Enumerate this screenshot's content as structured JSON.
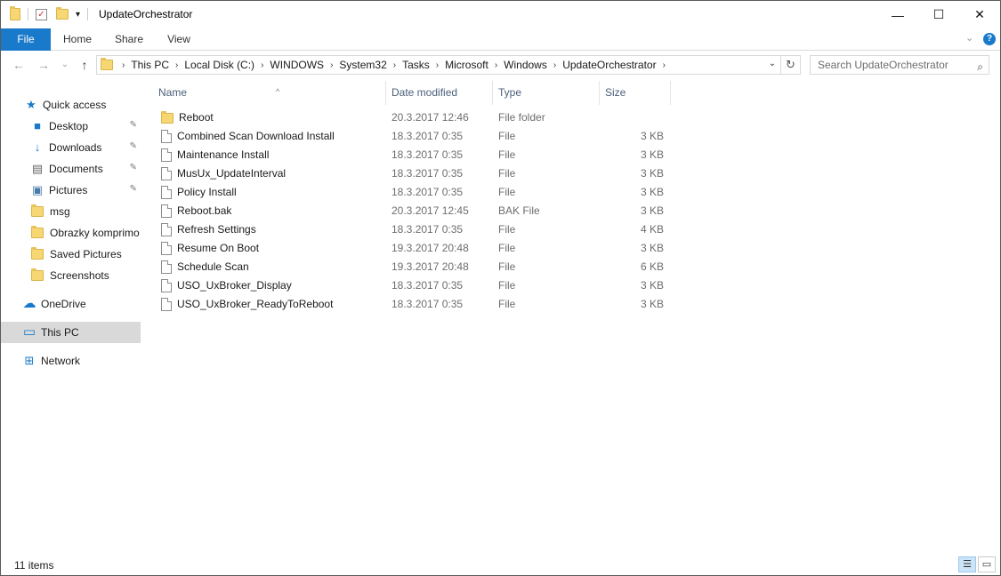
{
  "window": {
    "title": "UpdateOrchestrator",
    "minimize_label": "—",
    "maximize_label": "☐",
    "close_label": "✕",
    "help_label": "?",
    "collapse_ribbon_label": "⌄"
  },
  "ribbon": {
    "tabs": [
      {
        "label": "File"
      },
      {
        "label": "Home"
      },
      {
        "label": "Share"
      },
      {
        "label": "View"
      }
    ]
  },
  "nav_buttons": {
    "back": "←",
    "forward": "→",
    "recent": "⌄",
    "up": "↑"
  },
  "address": {
    "crumbs": [
      "This PC",
      "Local Disk (C:)",
      "WINDOWS",
      "System32",
      "Tasks",
      "Microsoft",
      "Windows",
      "UpdateOrchestrator"
    ],
    "separator": "›",
    "dropdown": "⌄",
    "refresh": "↻"
  },
  "search": {
    "placeholder": "Search UpdateOrchestrator",
    "icon": "⌕"
  },
  "navpane": {
    "items": [
      {
        "label": "Quick access",
        "icon": "★"
      },
      {
        "label": "Desktop",
        "icon": "■",
        "pin": "📌"
      },
      {
        "label": "Downloads",
        "icon": "↓",
        "pin": "📌"
      },
      {
        "label": "Documents",
        "icon": "▤",
        "pin": "📌"
      },
      {
        "label": "Pictures",
        "icon": "▣",
        "pin": "📌"
      },
      {
        "label": "msg"
      },
      {
        "label": "Obrazky komprimo"
      },
      {
        "label": "Saved Pictures"
      },
      {
        "label": "Screenshots"
      },
      {
        "label": "OneDrive",
        "icon": "☁"
      },
      {
        "label": "This PC",
        "icon": "▭"
      },
      {
        "label": "Network",
        "icon": "⊞"
      }
    ]
  },
  "columns": {
    "name": "Name",
    "date": "Date modified",
    "type": "Type",
    "size": "Size",
    "sort_indicator": "^"
  },
  "files": [
    {
      "name": "Reboot",
      "date": "20.3.2017 12:46",
      "type": "File folder",
      "size": ""
    },
    {
      "name": "Combined Scan Download Install",
      "date": "18.3.2017 0:35",
      "type": "File",
      "size": "3 KB"
    },
    {
      "name": "Maintenance Install",
      "date": "18.3.2017 0:35",
      "type": "File",
      "size": "3 KB"
    },
    {
      "name": "MusUx_UpdateInterval",
      "date": "18.3.2017 0:35",
      "type": "File",
      "size": "3 KB"
    },
    {
      "name": "Policy Install",
      "date": "18.3.2017 0:35",
      "type": "File",
      "size": "3 KB"
    },
    {
      "name": "Reboot.bak",
      "date": "20.3.2017 12:45",
      "type": "BAK File",
      "size": "3 KB"
    },
    {
      "name": "Refresh Settings",
      "date": "18.3.2017 0:35",
      "type": "File",
      "size": "4 KB"
    },
    {
      "name": "Resume On Boot",
      "date": "19.3.2017 20:48",
      "type": "File",
      "size": "3 KB"
    },
    {
      "name": "Schedule Scan",
      "date": "19.3.2017 20:48",
      "type": "File",
      "size": "6 KB"
    },
    {
      "name": "USO_UxBroker_Display",
      "date": "18.3.2017 0:35",
      "type": "File",
      "size": "3 KB"
    },
    {
      "name": "USO_UxBroker_ReadyToReboot",
      "date": "18.3.2017 0:35",
      "type": "File",
      "size": "3 KB"
    }
  ],
  "status": {
    "count": "11 items"
  }
}
